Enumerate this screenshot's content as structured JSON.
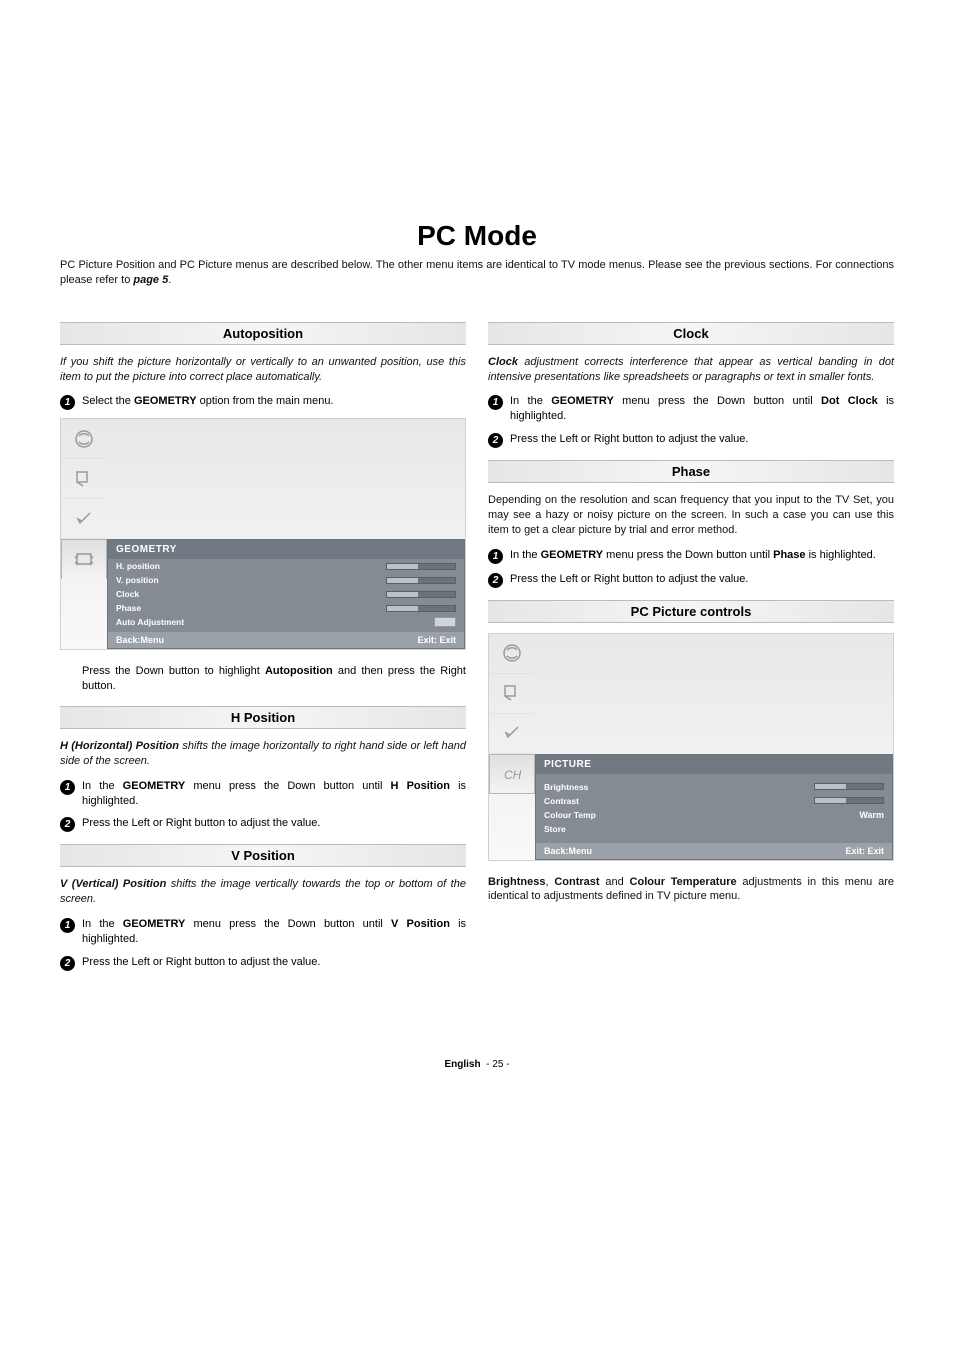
{
  "page": {
    "title": "PC Mode",
    "intro_plain": "PC Picture Position and PC Picture menus are described below. The other menu items are identical to TV mode menus. Please see the previous sections. For connections please refer to ",
    "intro_bold_italic": "page 5",
    "intro_end": "."
  },
  "left": {
    "autoposition": {
      "heading": "Autoposition",
      "desc": "If you shift the picture horizontally or vertically to an unwanted position, use this item to put the picture into correct place automatically.",
      "step1_pre": "Select the ",
      "step1_bold": "GEOMETRY",
      "step1_post": " option from the main menu.",
      "step2_pre": "Press the Down button to highlight ",
      "step2_bold": "Autoposition",
      "step2_post": " and then press the Right button."
    },
    "hposition": {
      "heading": "H Position",
      "desc_bold": "H (Horizontal) Position",
      "desc_rest": " shifts the image horizontally to right hand side or left hand side of the screen.",
      "step1_pre": "In the ",
      "step1_bold1": "GEOMETRY",
      "step1_mid": " menu press the Down button until ",
      "step1_bold2": "H Position",
      "step1_post": " is highlighted.",
      "step2": "Press the Left or Right button to adjust the value."
    },
    "vposition": {
      "heading": "V Position",
      "desc_bold": "V (Vertical) Position",
      "desc_rest": " shifts the image vertically towards the top or bottom of the screen.",
      "step1_pre": "In the ",
      "step1_bold1": "GEOMETRY",
      "step1_mid": " menu press the Down button until ",
      "step1_bold2": "V Position",
      "step1_post": " is highlighted.",
      "step2": "Press the Left or Right button to adjust the value."
    },
    "geom_menu": {
      "title": "GEOMETRY",
      "rows": [
        "H. position",
        "V. position",
        "Clock",
        "Phase",
        "Auto Adjustment"
      ],
      "back": "Back:Menu",
      "exit": "Exit: Exit"
    }
  },
  "right": {
    "clock": {
      "heading": "Clock",
      "desc_bold": "Clock",
      "desc_rest": " adjustment corrects interference that appear as vertical banding in dot intensive presentations like spreadsheets or paragraphs or text in smaller fonts.",
      "step1_pre": "In the ",
      "step1_bold1": "GEOMETRY",
      "step1_mid": " menu press the Down button until ",
      "step1_bold2": "Dot Clock",
      "step1_post": " is highlighted.",
      "step2": "Press the Left or Right button to adjust the value."
    },
    "phase": {
      "heading": "Phase",
      "desc": "Depending on the resolution and scan frequency that you input to the TV Set, you may see a hazy or noisy picture on the screen. In such a case you can use this item to get a clear picture by trial and error method.",
      "step1_pre": "In the ",
      "step1_bold1": "GEOMETRY",
      "step1_mid": " menu press the Down button until ",
      "step1_bold2": "Phase",
      "step1_post": " is highlighted.",
      "step2": "Press the Left or Right button to adjust the value."
    },
    "pcpicture": {
      "heading": "PC Picture controls",
      "menu_title": "PICTURE",
      "rows": [
        {
          "label": "Brightness",
          "type": "slider"
        },
        {
          "label": "Contrast",
          "type": "slider"
        },
        {
          "label": "Colour Temp",
          "type": "value",
          "value": "Warm"
        },
        {
          "label": "Store",
          "type": "none"
        }
      ],
      "back": "Back:Menu",
      "exit": "Exit: Exit",
      "footnote_b1": "Brightness",
      "footnote_s1": ", ",
      "footnote_b2": "Contrast",
      "footnote_s2": " and ",
      "footnote_b3": "Colour Temperature",
      "footnote_rest": " adjustments in this menu are identical to adjustments defined in TV picture menu."
    }
  },
  "footer": {
    "lang": "English",
    "page": "- 25 -"
  }
}
